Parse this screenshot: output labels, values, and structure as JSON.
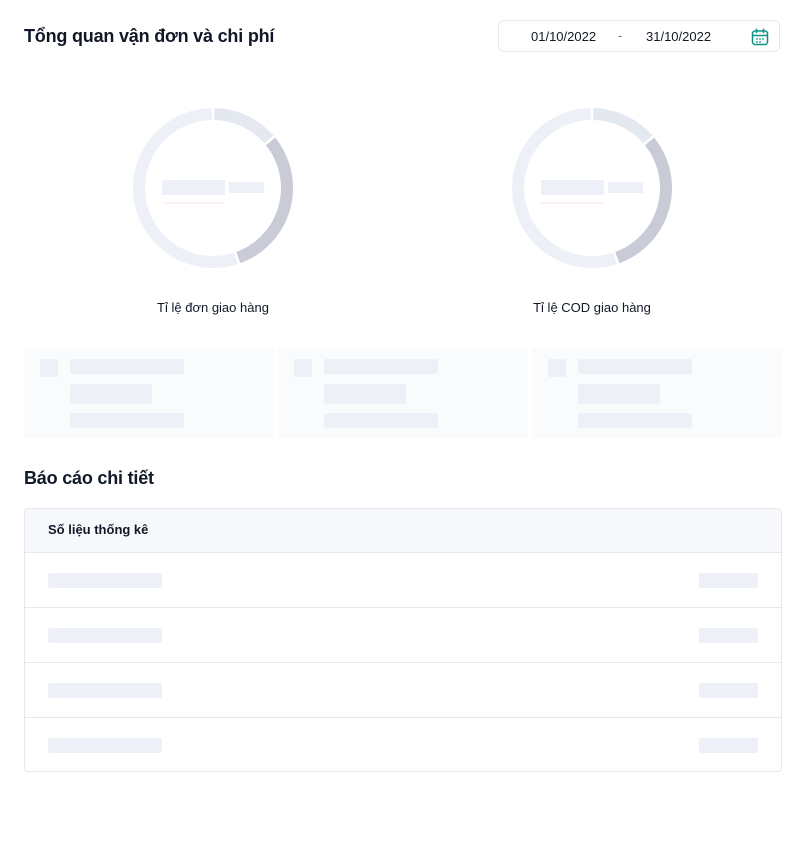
{
  "header": {
    "title": "Tổng quan vận đơn và chi phí",
    "date_start": "01/10/2022",
    "date_separator": "-",
    "date_end": "31/10/2022"
  },
  "charts": [
    {
      "caption": "Tỉ lệ đơn giao hàng"
    },
    {
      "caption": "Tỉ lệ COD giao hàng"
    }
  ],
  "details": {
    "title": "Báo cáo chi tiết",
    "table_header": "Số liệu thống kê",
    "row_count": 4
  },
  "colors": {
    "accent": "#0d9488",
    "skeleton": "#eef0f7",
    "donut_light": "#e4e8f1",
    "donut_dark": "#c9ccd6",
    "donut_bg": "#eef0f7"
  }
}
